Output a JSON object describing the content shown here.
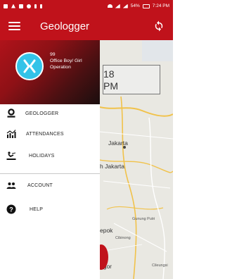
{
  "status_bar": {
    "battery": "54%",
    "time": "7:24 PM"
  },
  "app_bar": {
    "title": "Geologger"
  },
  "drawer": {
    "header": {
      "user_id": "99",
      "user_role": "Office Boy/ Girl Operation"
    },
    "items": [
      {
        "label": "GEOLOGGER",
        "icon": "map-pin-icon"
      },
      {
        "label": "ATTENDANCES",
        "icon": "chart-icon"
      },
      {
        "label": "HOLIDAYS",
        "icon": "beach-icon"
      },
      {
        "label": "ACCOUNT",
        "icon": "people-icon"
      },
      {
        "label": "HELP",
        "icon": "help-icon"
      }
    ]
  },
  "map": {
    "time_digits": "18",
    "time_suffix": "PM",
    "labels": [
      "Jakarta",
      "h Jakarta",
      "epok",
      "Gunung Putri",
      "Cibinong",
      "ogor",
      "Cileungsi"
    ]
  },
  "colors": {
    "primary": "#c0121b",
    "avatar": "#33c3e8"
  }
}
